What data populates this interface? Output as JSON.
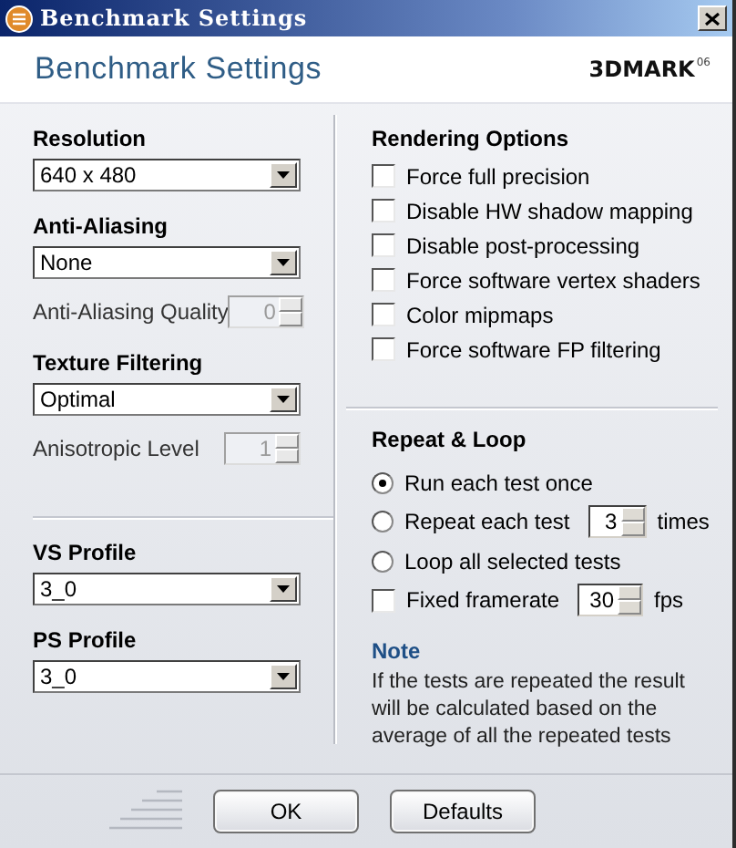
{
  "window": {
    "title": "Benchmark Settings"
  },
  "header": {
    "title": "Benchmark Settings",
    "logo": {
      "name": "3DMARK",
      "version": "06"
    }
  },
  "left_sections": [
    [
      {
        "kind": "dropdown",
        "label": "Resolution",
        "value": "640 x 480"
      },
      {
        "kind": "dropdown",
        "label": "Anti-Aliasing",
        "value": "None"
      },
      {
        "kind": "spinner",
        "label": "Anti-Aliasing Quality",
        "value": "0",
        "disabled": true
      },
      {
        "kind": "dropdown",
        "label": "Texture Filtering",
        "value": "Optimal"
      },
      {
        "kind": "spinner",
        "label": "Anisotropic Level",
        "value": "1",
        "disabled": true
      }
    ],
    [
      {
        "kind": "dropdown",
        "label": "VS Profile",
        "value": "3_0"
      },
      {
        "kind": "dropdown",
        "label": "PS Profile",
        "value": "3_0"
      }
    ]
  ],
  "rendering_options": {
    "title": "Rendering Options",
    "options": [
      {
        "label": "Force full precision",
        "checked": false
      },
      {
        "label": "Disable HW shadow mapping",
        "checked": false
      },
      {
        "label": "Disable post-processing",
        "checked": false
      },
      {
        "label": "Force software vertex shaders",
        "checked": false
      },
      {
        "label": "Color mipmaps",
        "checked": false
      },
      {
        "label": "Force software FP filtering",
        "checked": false
      }
    ]
  },
  "repeat_loop": {
    "title": "Repeat & Loop",
    "items": [
      {
        "kind": "radio",
        "label": "Run each test once",
        "selected": true
      },
      {
        "kind": "radio",
        "label": "Repeat each test",
        "selected": false,
        "spinner": {
          "value": "3",
          "disabled": false
        },
        "suffix": "times"
      },
      {
        "kind": "radio",
        "label": "Loop all selected tests",
        "selected": false
      },
      {
        "kind": "check",
        "label": "Fixed framerate",
        "checked": false,
        "spinner": {
          "value": "30",
          "disabled": false
        },
        "suffix": "fps"
      }
    ]
  },
  "note": {
    "title": "Note",
    "text": "If the tests are repeated the result will be calculated based on the average of all the repeated tests"
  },
  "buttons": [
    {
      "label": "OK"
    },
    {
      "label": "Defaults"
    }
  ]
}
